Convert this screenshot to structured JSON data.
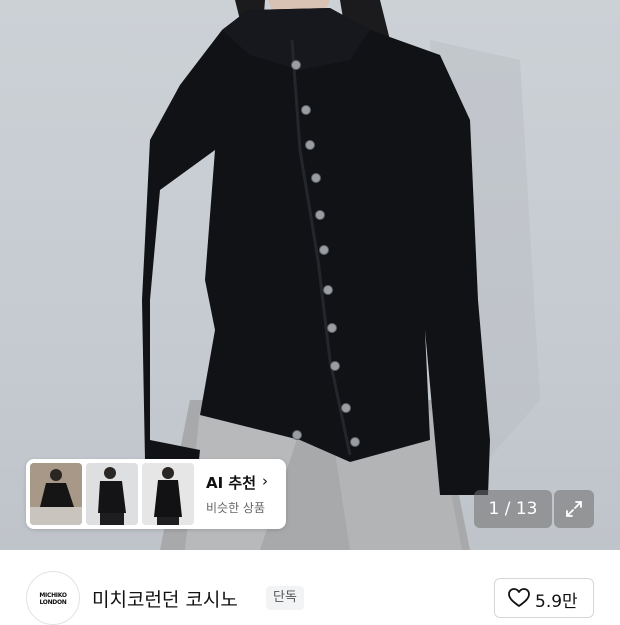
{
  "product_image": {
    "counter": "1 / 13",
    "expand_icon": "expand-arrows-icon"
  },
  "ai_recommend": {
    "title": "AI 추천",
    "chevron": "›",
    "subtitle": "비슷한 상품"
  },
  "brand": {
    "logo_text": "MICHIKO LONDON",
    "name": "미치코런던 코시노",
    "badge": "단독"
  },
  "like": {
    "icon": "heart-outline-icon",
    "count": "5.9만"
  }
}
